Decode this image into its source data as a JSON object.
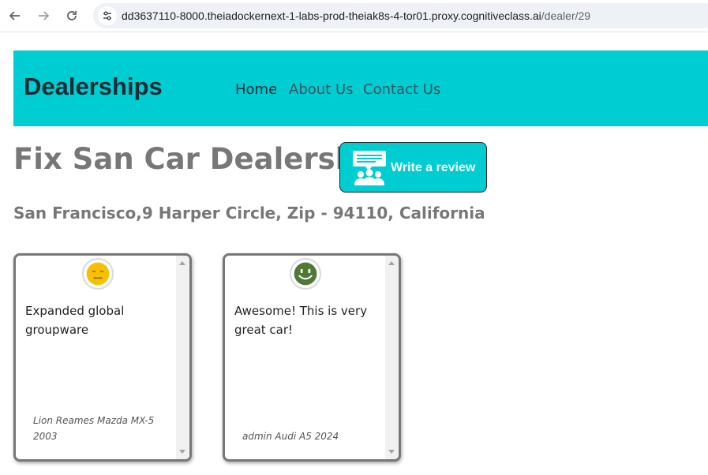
{
  "browser": {
    "url_host": "dd3637110-8000.theiadockernext-1-labs-prod-theiak8s-4-tor01.proxy.cognitiveclass.ai",
    "url_path": "/dealer/29",
    "icons": [
      "back-arrow-icon",
      "forward-arrow-icon",
      "reload-icon",
      "site-settings-icon"
    ]
  },
  "header": {
    "brand": "Dealerships",
    "nav": [
      {
        "label": "Home"
      },
      {
        "label": "About Us"
      },
      {
        "label": "Contact Us"
      }
    ],
    "background_color": "#00cdd1"
  },
  "dealer": {
    "name": "Fix San Car Dealership",
    "address": "San Francisco,9 Harper Circle, Zip - 94110, California",
    "write_review_label": "Write a review"
  },
  "reviews": [
    {
      "sentiment_icon": "neutral-face-icon",
      "sentiment_color": "#f6c000",
      "text": "Expanded global groupware",
      "meta": "Lion Reames Mazda MX-5 2003"
    },
    {
      "sentiment_icon": "smiling-face-icon",
      "sentiment_color": "#4f7a35",
      "text": "Awesome! This is very great car!",
      "meta": "admin Audi A5 2024"
    }
  ],
  "colors": {
    "accent": "#00cdd1",
    "title_gray": "#777777"
  }
}
